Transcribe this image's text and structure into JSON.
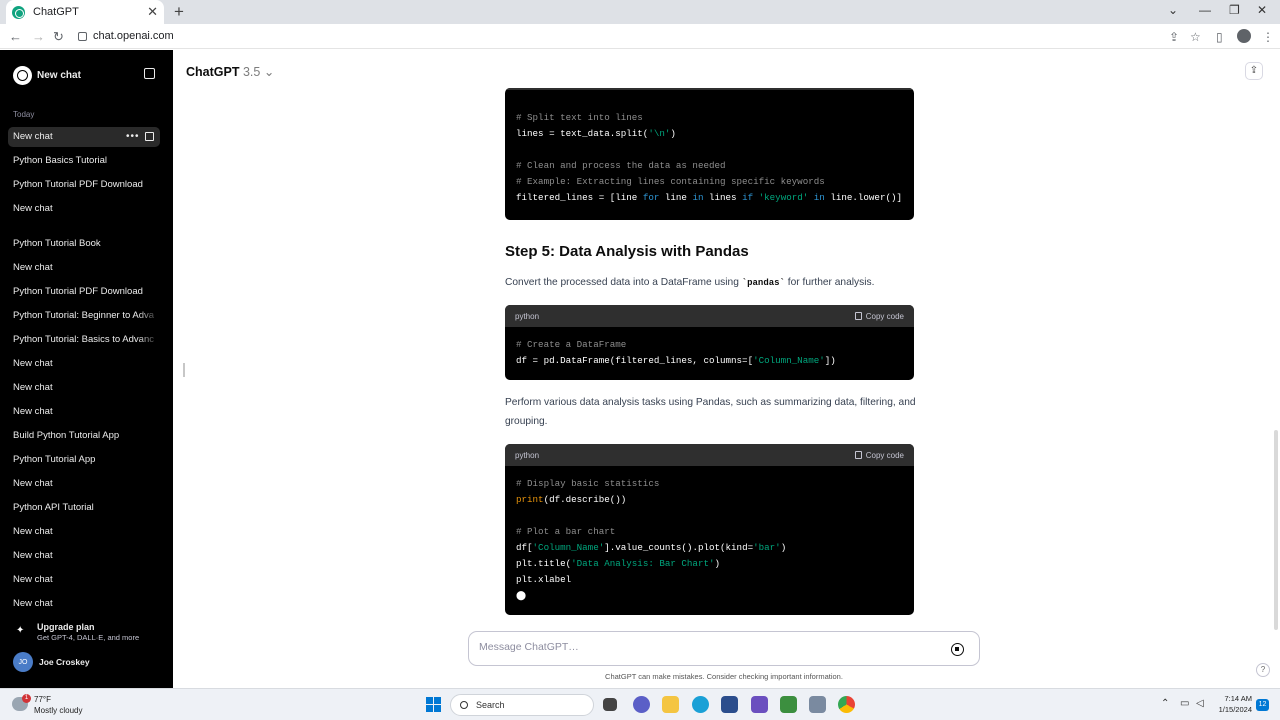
{
  "browser": {
    "tab_title": "ChatGPT",
    "url": "chat.openai.com"
  },
  "sidebar": {
    "new_chat_label": "New chat",
    "section_label": "Today",
    "items": [
      {
        "label": "New chat",
        "active": true
      },
      {
        "label": "Python Basics Tutorial"
      },
      {
        "label": "Python Tutorial PDF Download"
      },
      {
        "label": "New chat"
      },
      {
        "label": "Python Tutorial Book"
      },
      {
        "label": "New chat"
      },
      {
        "label": "Python Tutorial PDF Download"
      },
      {
        "label": "Python Tutorial: Beginner to Adva"
      },
      {
        "label": "Python Tutorial: Basics to Advanc"
      },
      {
        "label": "New chat"
      },
      {
        "label": "New chat"
      },
      {
        "label": "New chat"
      },
      {
        "label": "Build Python Tutorial App"
      },
      {
        "label": "Python Tutorial App"
      },
      {
        "label": "New chat"
      },
      {
        "label": "Python API Tutorial"
      },
      {
        "label": "New chat"
      },
      {
        "label": "New chat"
      },
      {
        "label": "New chat"
      },
      {
        "label": "New chat"
      }
    ],
    "more_icon": "•••",
    "upgrade": {
      "title": "Upgrade plan",
      "subtitle": "Get GPT-4, DALL·E, and more"
    },
    "user": {
      "initials": "JO",
      "name": "Joe Croskey"
    }
  },
  "main": {
    "model_title": "ChatGPT",
    "model_version": "3.5",
    "model_caret": "⌄",
    "copy_label": "Copy code",
    "lang_label": "python",
    "code1_lines": [
      [
        [
          "c-comment",
          "# Split text into lines"
        ]
      ],
      [
        [
          "",
          "lines = text_data.split("
        ],
        [
          "c-str",
          "'\\n'"
        ],
        [
          "",
          ")"
        ]
      ],
      [
        [
          "",
          ""
        ]
      ],
      [
        [
          "c-comment",
          "# Clean and process the data as needed"
        ]
      ],
      [
        [
          "c-comment",
          "# Example: Extracting lines containing specific keywords"
        ]
      ],
      [
        [
          "",
          "filtered_lines = [line "
        ],
        [
          "c-kw",
          "for"
        ],
        [
          "",
          " line "
        ],
        [
          "c-kw",
          "in"
        ],
        [
          "",
          " lines "
        ],
        [
          "c-kw",
          "if"
        ],
        [
          "",
          " "
        ],
        [
          "c-str",
          "'keyword'"
        ],
        [
          "",
          " "
        ],
        [
          "c-kw",
          "in"
        ],
        [
          "",
          " line.lower()]"
        ]
      ]
    ],
    "step_heading": "Step 5: Data Analysis with Pandas",
    "para1_before": "Convert the processed data into a DataFrame using ",
    "para1_code": "`pandas`",
    "para1_after": " for further analysis.",
    "code2_lines": [
      [
        [
          "c-comment",
          "# Create a DataFrame"
        ]
      ],
      [
        [
          "",
          "df = pd.DataFrame(filtered_lines, columns=["
        ],
        [
          "c-str",
          "'Column_Name'"
        ],
        [
          "",
          "])"
        ]
      ]
    ],
    "para2": "Perform various data analysis tasks using Pandas, such as summarizing data, filtering, and grouping.",
    "code3_lines": [
      [
        [
          "c-comment",
          "# Display basic statistics"
        ]
      ],
      [
        [
          "c-fn",
          "print"
        ],
        [
          "",
          "(df.describe())"
        ]
      ],
      [
        [
          "",
          ""
        ]
      ],
      [
        [
          "c-comment",
          "# Plot a bar chart"
        ]
      ],
      [
        [
          "",
          "df["
        ],
        [
          "c-str",
          "'Column_Name'"
        ],
        [
          "",
          "].value_counts().plot(kind="
        ],
        [
          "c-str",
          "'bar'"
        ],
        [
          "",
          ")"
        ]
      ],
      [
        [
          "",
          "plt.title("
        ],
        [
          "c-str",
          "'Data Analysis: Bar Chart'"
        ],
        [
          "",
          ")"
        ]
      ],
      [
        [
          "",
          "plt.xlabel"
        ]
      ],
      [
        [
          "",
          "⬤"
        ]
      ]
    ],
    "message_placeholder": "Message ChatGPT…",
    "disclaimer": "ChatGPT can make mistakes. Consider checking important information.",
    "help_label": "?"
  },
  "taskbar": {
    "weather_badge": "1",
    "temperature": "77°F",
    "condition": "Mostly cloudy",
    "search_label": "Search",
    "time": "7:14 AM",
    "date": "1/15/2024",
    "notification_count": "12"
  }
}
